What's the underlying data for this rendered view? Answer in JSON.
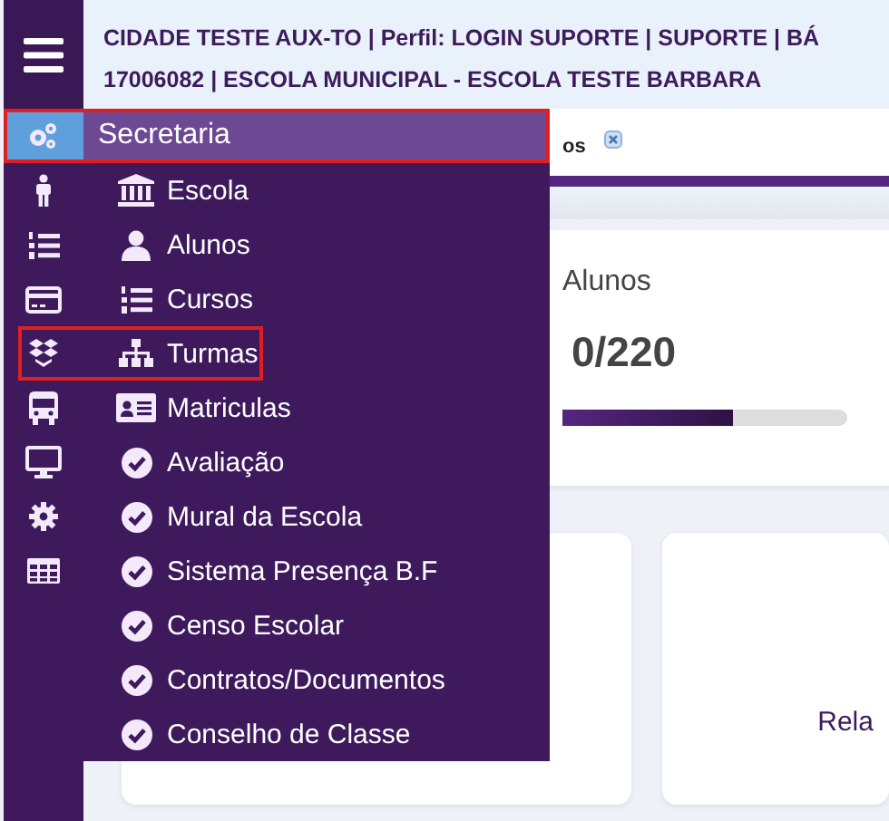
{
  "header": {
    "lines": [
      "CIDADE TESTE AUX-TO | Perfil: LOGIN SUPORTE | SUPORTE | BÁ",
      "17006082 | ESCOLA MUNICIPAL - ESCOLA TESTE BARBARA"
    ]
  },
  "tab": {
    "label": "os"
  },
  "rail": [
    {
      "kind": "gears",
      "selected": true
    },
    {
      "kind": "person",
      "selected": false
    },
    {
      "kind": "list",
      "selected": false
    },
    {
      "kind": "card",
      "selected": false
    },
    {
      "kind": "boxes",
      "selected": false
    },
    {
      "kind": "bus",
      "selected": false
    },
    {
      "kind": "monitor",
      "selected": false
    },
    {
      "kind": "cog",
      "selected": false
    },
    {
      "kind": "grid",
      "selected": false
    }
  ],
  "menu": {
    "title": "Secretaria",
    "highlighted": true,
    "items": [
      {
        "label": "Escola",
        "kind": "building",
        "highlighted": false
      },
      {
        "label": "Alunos",
        "kind": "user",
        "highlighted": false
      },
      {
        "label": "Cursos",
        "kind": "list",
        "highlighted": false
      },
      {
        "label": "Turmas",
        "kind": "tree",
        "highlighted": true
      },
      {
        "label": "Matriculas",
        "kind": "idcard",
        "highlighted": false
      },
      {
        "label": "Avaliação",
        "kind": "check",
        "highlighted": false
      },
      {
        "label": "Mural da Escola",
        "kind": "check",
        "highlighted": false
      },
      {
        "label": "Sistema Presença B.F",
        "kind": "check",
        "highlighted": false
      },
      {
        "label": "Censo Escolar",
        "kind": "check",
        "highlighted": false
      },
      {
        "label": "Contratos/Documentos",
        "kind": "check",
        "highlighted": false
      },
      {
        "label": "Conselho de Classe",
        "kind": "check",
        "highlighted": false
      }
    ]
  },
  "students_card": {
    "title": "Alunos",
    "value": "0/220",
    "level": 0.6
  },
  "report_card": {
    "text": "Rela"
  }
}
